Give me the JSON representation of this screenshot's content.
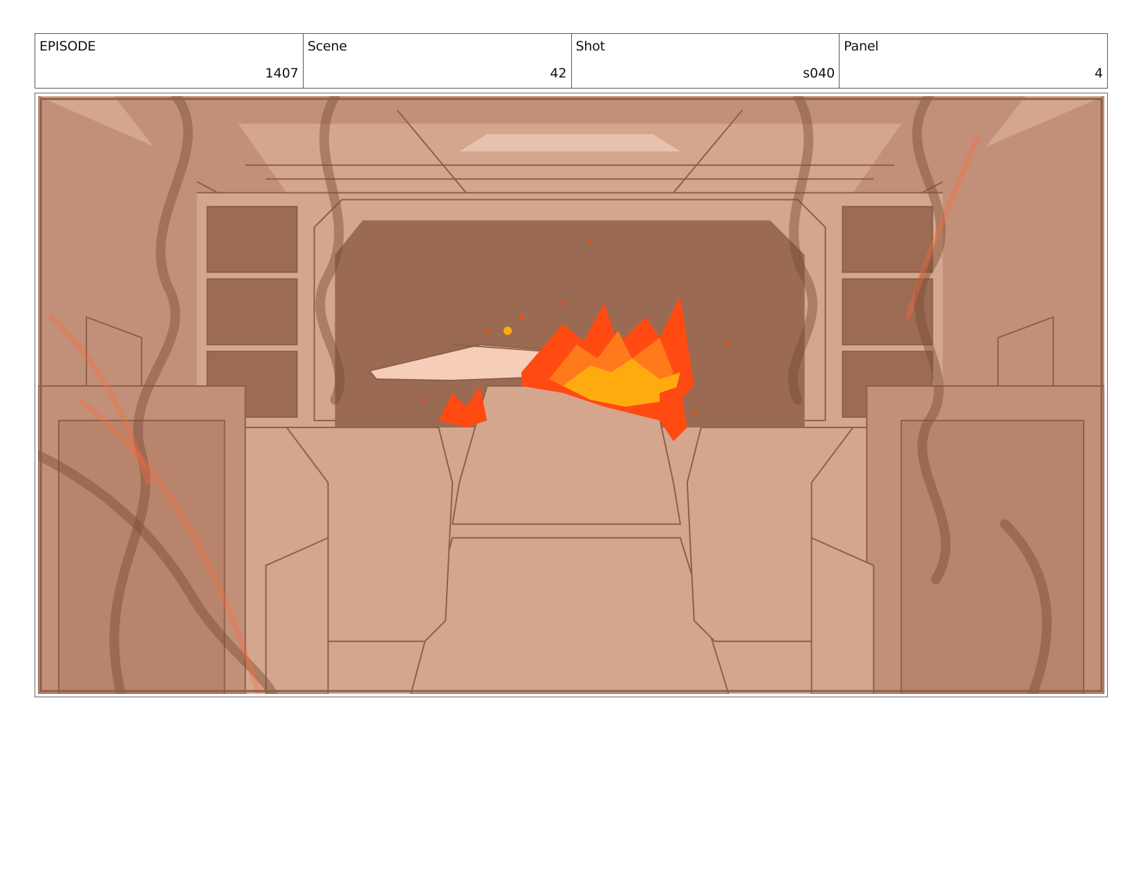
{
  "header": {
    "cells": [
      {
        "label": "EPISODE",
        "value": "1407"
      },
      {
        "label": "Scene",
        "value": "42"
      },
      {
        "label": "Shot",
        "value": "s040"
      },
      {
        "label": "Panel",
        "value": "4"
      }
    ]
  },
  "panel": {
    "palette": {
      "base": "#d3a68d",
      "mid": "#c29078",
      "dark": "#9b6b53",
      "line": "#8d5f48",
      "window": "#9a6a52",
      "flame_red": "#ff4a12",
      "flame_orange": "#ff7a1a",
      "flame_yellow": "#ffab10",
      "missile": "#f6cdb9"
    }
  }
}
